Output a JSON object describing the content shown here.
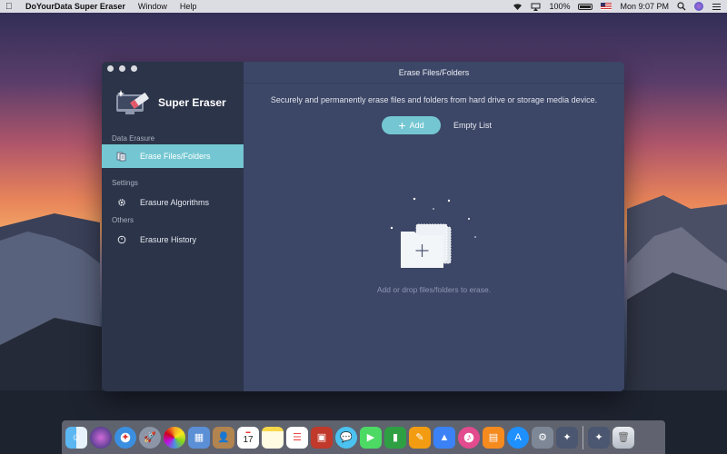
{
  "menubar": {
    "app_name": "DoYourData Super Eraser",
    "menus": [
      "Window",
      "Help"
    ],
    "battery_percent": "100%",
    "clock": "Mon 9:07 PM"
  },
  "sidebar": {
    "brand_name": "Super Eraser",
    "sections": {
      "data_erasure": "Data Erasure",
      "settings": "Settings",
      "others": "Others"
    },
    "items": [
      {
        "label": "Erase Files/Folders",
        "icon": "files-icon",
        "active": true
      },
      {
        "label": "Erasure Algorithms",
        "icon": "gear-icon",
        "active": false
      },
      {
        "label": "Erasure History",
        "icon": "history-icon",
        "active": false
      }
    ]
  },
  "main": {
    "title": "Erase Files/Folders",
    "subtitle": "Securely and permanently erase files and folders from hard drive or storage media device.",
    "add_label": "Add",
    "empty_list_label": "Empty List",
    "drop_hint": "Add or drop files/folders to erase."
  },
  "colors": {
    "accent": "#74c7d2",
    "sidebar_bg": "#2c3449",
    "main_bg": "#3c4666"
  },
  "dock": {
    "icons": [
      "finder-icon",
      "siri-icon",
      "safari-icon",
      "launchpad-icon",
      "photos-icon",
      "preview-icon",
      "contacts-icon",
      "calendar-icon",
      "notes-icon",
      "reminders-icon",
      "photo-booth-icon",
      "messages-icon",
      "facetime-icon",
      "numbers-icon",
      "pages-icon",
      "keynote-icon",
      "itunes-icon",
      "ibooks-icon",
      "app-store-icon",
      "system-preferences-icon",
      "super-eraser-icon",
      "super-eraser-icon-2",
      "trash-icon"
    ],
    "calendar_day": "17"
  }
}
